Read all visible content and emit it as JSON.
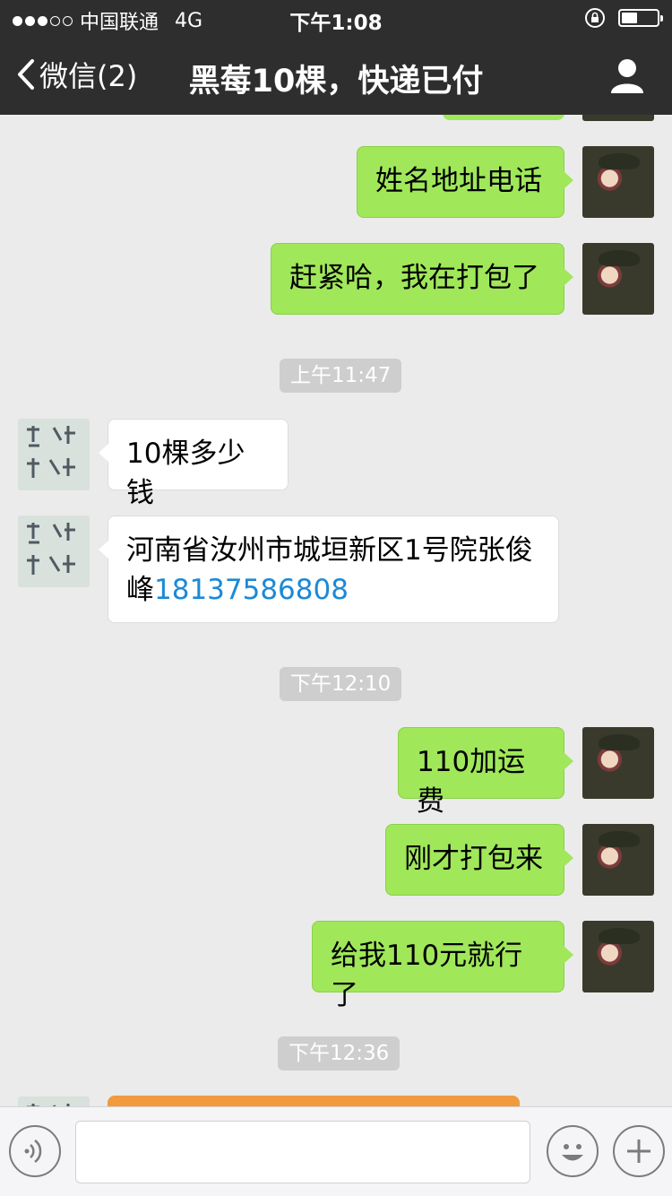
{
  "status_bar": {
    "carrier": "中国联通",
    "network": "4G",
    "time": "下午1:08",
    "signal_dots_filled": 3,
    "signal_dots_total": 5,
    "battery_level": 0.45
  },
  "nav": {
    "back_label": "微信(2)",
    "title": "黑莓10棵，快递已付"
  },
  "messages": [
    {
      "side": "me",
      "text": "姓名地址电话"
    },
    {
      "side": "me",
      "text": "赶紧哈，我在打包了"
    },
    {
      "time": "上午11:47"
    },
    {
      "side": "other",
      "text": "10棵多少钱"
    },
    {
      "side": "other",
      "text_main": "河南省汝州市城垣新区1号院张俊峰",
      "phone": "18137586808"
    },
    {
      "time": "下午12:10"
    },
    {
      "side": "me",
      "text": "110加运费"
    },
    {
      "side": "me",
      "text": "刚才打包来"
    },
    {
      "side": "me",
      "text": "给我110元就行了"
    },
    {
      "time": "下午12:36"
    }
  ],
  "colors": {
    "bar_bg": "#2e2e2e",
    "chat_bg": "#ebebeb",
    "bubble_me": "#a0e75a",
    "bubble_other": "#ffffff",
    "link": "#1b8ad6",
    "partial_card": "#f19a3e"
  },
  "icons": {
    "back": "chevron-left-icon",
    "profile": "person-icon",
    "voice": "voice-icon",
    "emoji": "emoji-icon",
    "plus": "plus-icon",
    "lock": "rotation-lock-icon"
  }
}
